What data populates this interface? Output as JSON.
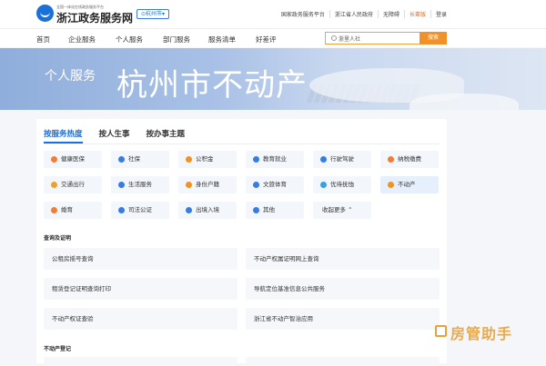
{
  "header": {
    "logo_small": "全国一体化在线政务服务平台",
    "logo_main": "浙江政务服务网",
    "city": "⊙杭州市▾",
    "links": [
      "国家政务服务平台",
      "浙江省人民政府",
      "无障碍",
      "长辈版",
      "登录"
    ]
  },
  "nav": {
    "items": [
      "首页",
      "企业服务",
      "个人服务",
      "部门服务",
      "服务清单",
      "好差评"
    ],
    "search_value": "浙里人社",
    "search_button": "搜索"
  },
  "banner": {
    "subtitle": "个人服务",
    "title": "杭州市不动产"
  },
  "tabs": [
    "按服务热度",
    "按人生事",
    "按办事主题"
  ],
  "categories": [
    {
      "label": "健康医保",
      "icon": "health-icon",
      "color": "#f07d3a"
    },
    {
      "label": "社保",
      "icon": "shield-icon",
      "color": "#3a7be0"
    },
    {
      "label": "公积金",
      "icon": "coin-icon",
      "color": "#f0912a"
    },
    {
      "label": "教育就业",
      "icon": "education-icon",
      "color": "#3a7be0"
    },
    {
      "label": "行驶驾驶",
      "icon": "car-icon",
      "color": "#3a7be0"
    },
    {
      "label": "纳税缴费",
      "icon": "tax-icon",
      "color": "#f07d3a"
    },
    {
      "label": "交通出行",
      "icon": "traffic-icon",
      "color": "#f0a030"
    },
    {
      "label": "生活服务",
      "icon": "life-icon",
      "color": "#3a7be0"
    },
    {
      "label": "身份户籍",
      "icon": "id-icon",
      "color": "#f0912a"
    },
    {
      "label": "文旅体育",
      "icon": "culture-icon",
      "color": "#3a7be0"
    },
    {
      "label": "优待抚恤",
      "icon": "care-icon",
      "color": "#3aa0e0"
    },
    {
      "label": "不动产",
      "icon": "house-icon",
      "color": "#f0912a"
    },
    {
      "label": "婚育",
      "icon": "marriage-icon",
      "color": "#f07d3a"
    },
    {
      "label": "司法公证",
      "icon": "justice-icon",
      "color": "#3a7be0"
    },
    {
      "label": "出境入境",
      "icon": "passport-icon",
      "color": "#3a7be0"
    },
    {
      "label": "其他",
      "icon": "grid-icon",
      "color": "#3a7be0"
    },
    {
      "label": "收起更多 ⌃",
      "icon": "",
      "color": ""
    }
  ],
  "sections": [
    {
      "title": "查询及证明",
      "items": [
        "公租房摇号查询",
        "不动产权属证明网上查询",
        "租赁登记证明查询打印",
        "导航定位基准信息公共服务",
        "不动产权证查验",
        "浙江省不动产智治应用"
      ]
    },
    {
      "title": "不动产登记",
      "items": []
    }
  ],
  "watermark": "房管助手",
  "colors": {
    "accent": "#1b6fd8",
    "orange": "#f0912a"
  }
}
